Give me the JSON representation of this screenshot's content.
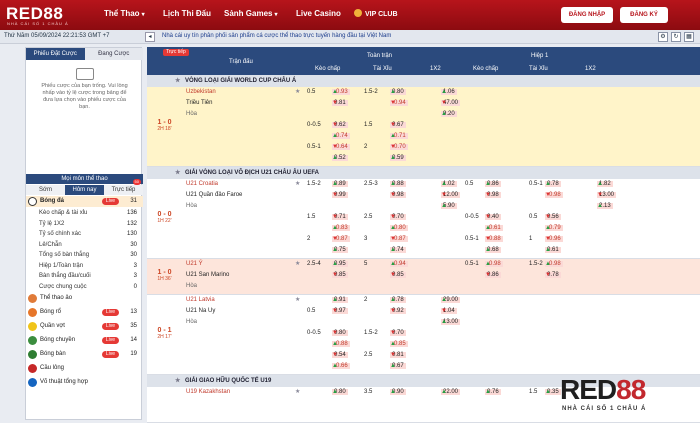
{
  "brand": {
    "logo": "RED88",
    "tagline": "NHÀ CÁI SỐ 1 CHÂU Á"
  },
  "nav": {
    "items": [
      "Thể Thao",
      "Lịch Thi Đấu",
      "Sảnh Games",
      "Live Casino"
    ],
    "vip": "VIP CLUB",
    "login": "ĐĂNG NHẬP",
    "register": "ĐĂNG KÝ"
  },
  "infobar": {
    "clock": "Thứ Năm 05/09/2024 22:21:53 GMT +7",
    "message": "Nhà cái uy tín phân phối sản phẩm cá cược thể thao trực tuyến hàng đầu tại Việt Nam"
  },
  "sidebar": {
    "tabs": [
      "Phiếu Đặt Cược",
      "Đang Cược"
    ],
    "slip_text": "Phiếu cược của bạn trống. Vui lòng nhấp vào tỷ lệ cược trong bảng để đưa lựa chọn vào phiếu cược của bạn.",
    "section": "Mọi môn thể thao",
    "subtabs": [
      "Sớm",
      "Hôm nay",
      "Trực tiếp"
    ],
    "live_count": "50",
    "main_sport": {
      "name": "Bóng đá",
      "live": "Live",
      "count": "31"
    },
    "bet_types": [
      {
        "name": "Kèo chấp & tài xỉu",
        "count": "136"
      },
      {
        "name": "Tỷ lệ 1X2",
        "count": "132"
      },
      {
        "name": "Tỷ số chính xác",
        "count": "130"
      },
      {
        "name": "Lẻ/Chẵn",
        "count": "30"
      },
      {
        "name": "Tổng số bàn thắng",
        "count": "30"
      },
      {
        "name": "Hiệp 1/Toàn trận",
        "count": "3"
      },
      {
        "name": "Bàn thắng đầu/cuối",
        "count": "3"
      },
      {
        "name": "Cược chung cuộc",
        "count": "0"
      }
    ],
    "sports": [
      {
        "name": "Thể thao ảo",
        "live": "",
        "count": ""
      },
      {
        "name": "Bóng rổ",
        "live": "Live",
        "count": "13"
      },
      {
        "name": "Quần vợt",
        "live": "Live",
        "count": "35"
      },
      {
        "name": "Bóng chuyền",
        "live": "Live",
        "count": "14"
      },
      {
        "name": "Bóng bàn",
        "live": "Live",
        "count": "19"
      },
      {
        "name": "Cầu lông",
        "live": "",
        "count": ""
      },
      {
        "name": "Võ thuật tổng hợp",
        "live": "",
        "count": ""
      }
    ]
  },
  "table": {
    "live_label": "Trực tiếp",
    "match_header": "Trận đấu",
    "full": "Toàn trận",
    "half": "Hiệp 1",
    "cols": [
      "Kèo chấp",
      "Tài Xỉu",
      "1X2",
      "Kèo chấp",
      "Tài Xỉu",
      "1X2"
    ]
  },
  "leagues": [
    "VÒNG LOẠI GIẢI WORLD CUP CHÂU Á",
    "GIẢI VÒNG LOẠI VÔ ĐỊCH U21 CHÂU ÂU UEFA",
    "GIẢI GIAO HỮU QUỐC TẾ U19"
  ],
  "matches": [
    {
      "score": "1 - 0",
      "time": "2H 18'",
      "home": "Uzbekistan",
      "away": "Triều Tiên",
      "draw": "Hòa",
      "lines": [
        [
          "0.5",
          "-0.93",
          "1.5-2",
          "0.80",
          "1.06",
          "",
          "",
          "",
          "",
          ""
        ],
        [
          "",
          "0.81",
          "",
          "-0.94",
          "47.00",
          "",
          "",
          "",
          "",
          ""
        ],
        [
          "",
          "",
          "",
          "",
          "9.20",
          "",
          "",
          "",
          "",
          ""
        ],
        [
          "0-0.5",
          "0.62",
          "1.5",
          "0.67",
          "",
          "",
          "",
          "",
          "",
          ""
        ],
        [
          "",
          "-0.74",
          "",
          "-0.71",
          "",
          "",
          "",
          "",
          "",
          ""
        ],
        [
          "0.5-1",
          "-0.64",
          "2",
          "-0.70",
          "",
          "",
          "",
          "",
          "",
          ""
        ],
        [
          "",
          "0.52",
          "",
          "0.59",
          "",
          "",
          "",
          "",
          "",
          ""
        ]
      ]
    },
    {
      "score": "0 - 0",
      "time": "1H 22'",
      "home": "U21 Croatia",
      "away": "U21 Quần đảo Faroe",
      "draw": "Hòa",
      "lines": [
        [
          "1.5-2",
          "0.89",
          "2.5-3",
          "0.88",
          "1.02",
          "0.5",
          "0.86",
          "0.5-1",
          "0.78",
          "1.82"
        ],
        [
          "",
          "0.99",
          "",
          "0.98",
          "12.00",
          "",
          "0.98",
          "",
          "-0.98",
          "13.00"
        ],
        [
          "",
          "",
          "",
          "",
          "5.90",
          "",
          "",
          "",
          "",
          "2.13"
        ],
        [
          "1.5",
          "0.71",
          "2.5",
          "0.70",
          "",
          "0-0.5",
          "0.40",
          "0.5",
          "0.56",
          ""
        ],
        [
          "",
          "-0.83",
          "",
          "-0.80",
          "",
          "",
          "-0.61",
          "",
          "-0.79",
          ""
        ],
        [
          "2",
          "-0.87",
          "3",
          "-0.87",
          "",
          "0.5-1",
          "-0.88",
          "1",
          "-0.96",
          ""
        ],
        [
          "",
          "0.75",
          "",
          "0.74",
          "",
          "",
          "0.68",
          "",
          "0.61",
          ""
        ]
      ]
    },
    {
      "score": "1 - 0",
      "time": "1H 36'",
      "home": "U21 Ý",
      "away": "U21 San Marino",
      "draw": "Hòa",
      "lines": [
        [
          "2.5-4",
          "0.95",
          "5",
          "-0.94",
          "",
          "0.5-1",
          "-0.98",
          "1.5-2",
          "-0.98",
          ""
        ],
        [
          "",
          "0.85",
          "",
          "0.85",
          "",
          "",
          "0.86",
          "",
          "0.78",
          ""
        ]
      ]
    },
    {
      "score": "0 - 1",
      "time": "2H 17'",
      "home": "U21 Latvia",
      "away": "U21 Na Uy",
      "draw": "Hòa",
      "lines": [
        [
          "",
          "0.91",
          "2",
          "0.78",
          "29.00",
          "",
          "",
          "",
          "",
          ""
        ],
        [
          "0.5",
          "0.97",
          "",
          "0.92",
          "1.04",
          "",
          "",
          "",
          "",
          ""
        ],
        [
          "",
          "",
          "",
          "",
          "13.00",
          "",
          "",
          "",
          "",
          ""
        ],
        [
          "0-0.5",
          "0.80",
          "1.5-2",
          "0.70",
          "",
          "",
          "",
          "",
          "",
          ""
        ],
        [
          "",
          "-0.88",
          "",
          "-0.85",
          "",
          "",
          "",
          "",
          "",
          ""
        ],
        [
          "",
          "0.54",
          "2.5",
          "0.81",
          "",
          "",
          "",
          "",
          "",
          ""
        ],
        [
          "",
          "-0.66",
          "",
          "0.67",
          "",
          "",
          "",
          "",
          "",
          ""
        ]
      ]
    },
    {
      "score": "",
      "time": "",
      "home": "U19 Kazakhstan",
      "away": "",
      "draw": "",
      "lines": [
        [
          "",
          "0.80",
          "3.5",
          "0.90",
          "22.00",
          "",
          "0.76",
          "1.5",
          "0.35",
          ""
        ]
      ]
    }
  ]
}
